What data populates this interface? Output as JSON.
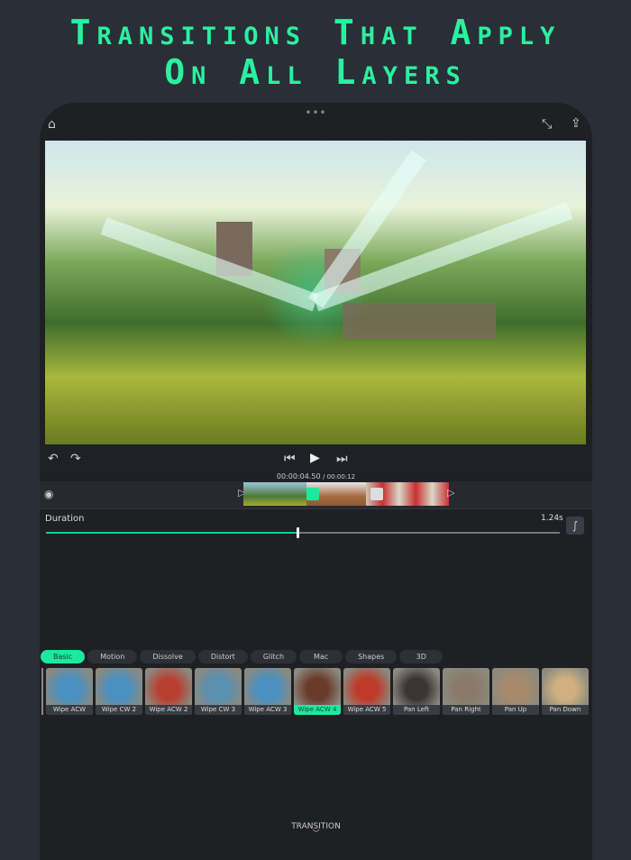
{
  "headline": {
    "line1": "Transitions That Apply",
    "line2": "On All Layers"
  },
  "header": {
    "dots": "•••"
  },
  "playback": {
    "current_time": "00:00:04.50",
    "total_time": "/ 00:00:12"
  },
  "duration": {
    "label": "Duration",
    "value": "1.24s",
    "progress": 0.49
  },
  "categories": [
    {
      "label": "Basic",
      "active": true
    },
    {
      "label": "Motion"
    },
    {
      "label": "Dissolve"
    },
    {
      "label": "Distort"
    },
    {
      "label": "Glitch"
    },
    {
      "label": "Mac"
    },
    {
      "label": "Shapes"
    },
    {
      "label": "3D"
    }
  ],
  "transitions": [
    {
      "label": "Wipe ACW",
      "color": "#4a90c0"
    },
    {
      "label": "Wipe CW 2",
      "color": "#4a90c0"
    },
    {
      "label": "Wipe ACW 2",
      "color": "#b84030"
    },
    {
      "label": "Wipe CW 3",
      "color": "#5a90b0"
    },
    {
      "label": "Wipe ACW 3",
      "color": "#4a90c0"
    },
    {
      "label": "Wipe ACW 4",
      "color": "#6a3a2a",
      "selected": true
    },
    {
      "label": "Wipe ACW 5",
      "color": "#c03a2a"
    },
    {
      "label": "Pan Left",
      "color": "#3a3434"
    },
    {
      "label": "Pan Right",
      "color": "#8a7a6a"
    },
    {
      "label": "Pan Up",
      "color": "#a88a6a"
    },
    {
      "label": "Pan Down",
      "color": "#d0b080"
    }
  ],
  "footer": {
    "label": "TRANSITION"
  },
  "colors": {
    "accent": "#1ee8a0",
    "headline": "#2af0a0"
  }
}
